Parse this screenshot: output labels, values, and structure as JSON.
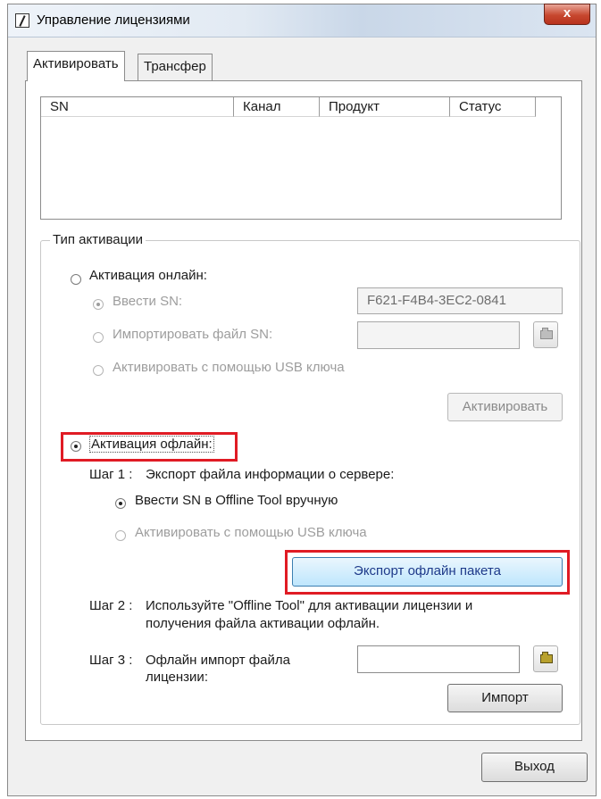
{
  "window": {
    "title": "Управление лицензиями",
    "close_glyph": "x"
  },
  "tabs": [
    {
      "label": "Активировать",
      "selected": true
    },
    {
      "label": "Трансфер",
      "selected": false
    }
  ],
  "table": {
    "columns": [
      "SN",
      "Канал",
      "Продукт",
      "Статус"
    ],
    "rows": []
  },
  "activation_type": {
    "group_label": "Тип активации",
    "online": {
      "label": "Активация онлайн:",
      "selected": false,
      "enter_sn_label": "Ввести SN:",
      "enter_sn_value": "F621-F4B4-3EC2-0841",
      "import_sn_file_label": "Импортировать файл SN:",
      "import_sn_file_value": "",
      "usb_key_label": "Активировать с помощью USB ключа",
      "activate_button": "Активировать"
    },
    "offline": {
      "label": "Активация офлайн:",
      "selected": true,
      "step1_label": "Шаг 1 :",
      "step1_text": "Экспорт файла информации о сервере:",
      "manual_sn_label": "Ввести SN в Offline Tool вручную",
      "usb_key_label": "Активировать с помощью USB ключа",
      "export_button": "Экспорт офлайн пакета",
      "step2_label": "Шаг 2 :",
      "step2_text_line1": "Используйте \"Offline Tool\" для активации лицензии и",
      "step2_text_line2": "получения файла активации офлайн.",
      "step3_label": "Шаг 3 :",
      "step3_text_line1": "Офлайн импорт файла",
      "step3_text_line2": "лицензии:",
      "step3_file_value": "",
      "import_button": "Импорт"
    }
  },
  "footer": {
    "exit_button": "Выход"
  },
  "colors": {
    "highlight": "#e01b24",
    "accent_button": "#bee6fd"
  },
  "icons": {
    "app": "license-app-icon",
    "browse": "folder-open-icon"
  }
}
